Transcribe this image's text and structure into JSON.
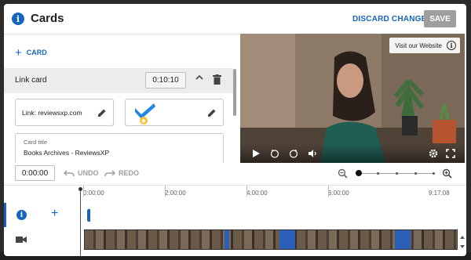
{
  "header": {
    "title": "Cards",
    "discard_label": "DISCARD CHANGES",
    "save_label": "SAVE"
  },
  "editor": {
    "add_card_label": "CARD",
    "card": {
      "type_label": "Link card",
      "time": "0:10:10",
      "link_text": "Link: reviewsxp.com",
      "title_label": "Card title",
      "title_value": "Books Archives - ReviewsXP"
    }
  },
  "preview": {
    "visit_label": "Visit our Website"
  },
  "timeline_bar": {
    "current_time": "0:00:00",
    "undo_label": "UNDO",
    "redo_label": "REDO"
  },
  "timeline": {
    "ticks": [
      "0:00:00",
      "2:00:00",
      "4:00:00",
      "6:00:00",
      "9:17:08"
    ]
  },
  "colors": {
    "accent": "#1565c0",
    "save_disabled": "#9e9e9e"
  }
}
